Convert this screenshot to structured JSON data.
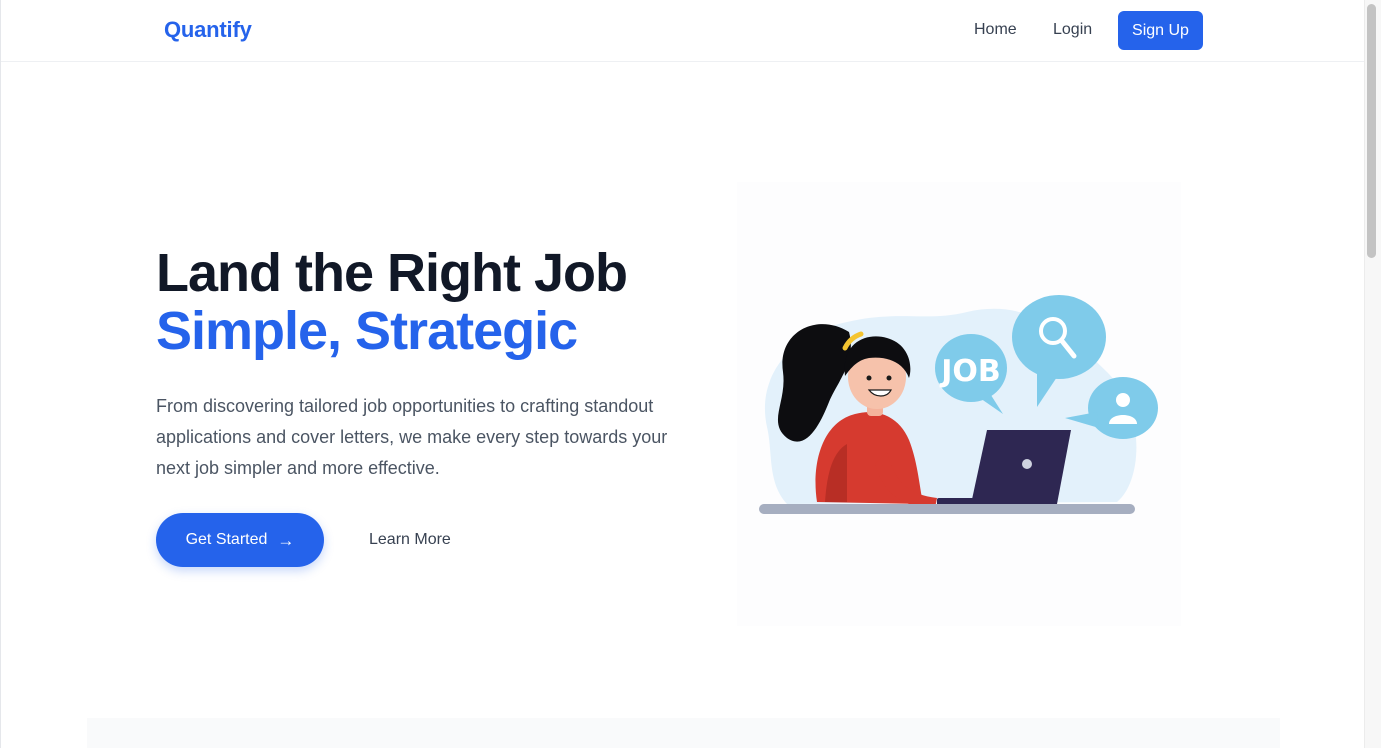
{
  "header": {
    "logo": "Quantify",
    "nav": {
      "home": "Home",
      "login": "Login",
      "signup": "Sign Up"
    }
  },
  "hero": {
    "title_line1": "Land the Right Job",
    "title_line2": "Simple, Strategic",
    "description": "From discovering tailored job opportunities to crafting standout applications and cover letters, we make every step towards your next job simpler and more effective.",
    "primary_cta": "Get Started",
    "primary_cta_icon": "arrow-right-icon",
    "secondary_cta": "Learn More"
  },
  "illustration": {
    "bubble_text": "JOB",
    "icons": [
      "search-icon",
      "user-icon"
    ]
  },
  "colors": {
    "brand": "#2563eb",
    "heading": "#111827",
    "body": "#4b5563",
    "illustration_blue": "#7fcbea",
    "illustration_bg": "#e3f1fb",
    "shirt": "#d63a2f",
    "laptop": "#2e2752"
  }
}
